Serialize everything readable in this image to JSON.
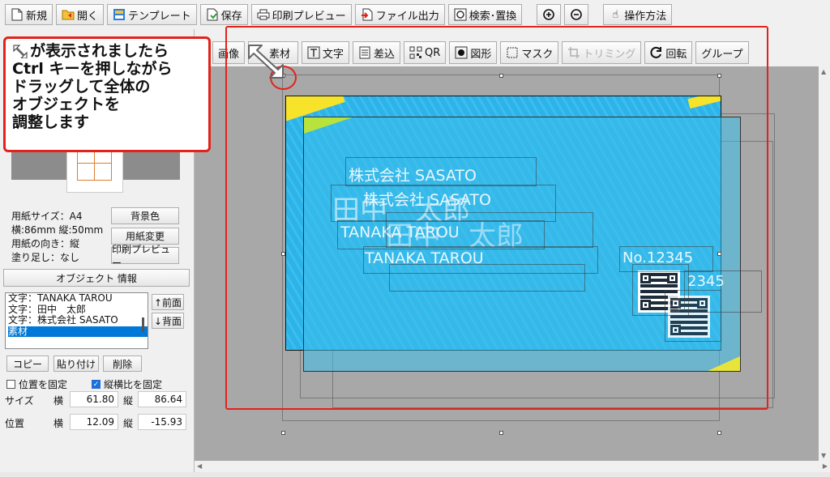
{
  "toolbar": {
    "new_label": "新規",
    "open_label": "開く",
    "template_label": "テンプレート",
    "save_label": "保存",
    "print_preview_label": "印刷プレビュー",
    "file_output_label": "ファイル出力",
    "search_replace_label": "検索･置換",
    "zoom_in_icon": "zoom-in-icon",
    "zoom_out_icon": "zoom-out-icon",
    "help_label": "操作方法"
  },
  "toolbar2": {
    "image_label": "画像",
    "material_label": "素材",
    "text_label": "文字",
    "merge_label": "差込",
    "qr_label": "QR",
    "shape_label": "図形",
    "mask_label": "マスク",
    "trimming_label": "トリミング",
    "rotate_label": "回転",
    "group_label": "グループ"
  },
  "paper": {
    "size": "用紙サイズ：A4",
    "dimensions": "横:86mm 縦:50mm",
    "orientation": "用紙の向き：縦",
    "bleed": "塗り足し：なし",
    "bg_color_button": "背景色",
    "change_paper_button": "用紙変更",
    "print_preview_button": "印刷プレビュー"
  },
  "object_info": {
    "header": "オブジェクト 情報",
    "items": [
      {
        "label": "文字：TANAKA TAROU",
        "selected": false
      },
      {
        "label": "文字：田中　太郎",
        "selected": false
      },
      {
        "label": "文字：株式会社 SASATO",
        "selected": false
      },
      {
        "label": "素材",
        "selected": true
      }
    ],
    "front_button": "↑前面",
    "back_button": "↓背面",
    "copy_button": "コピー",
    "paste_button": "貼り付け",
    "delete_button": "削除",
    "lock_position": {
      "label": "位置を固定",
      "checked": false
    },
    "keep_ratio": {
      "label": "縦横比を固定",
      "checked": true
    },
    "size_label": "サイズ",
    "position_label": "位置",
    "width_label": "横",
    "height_label": "縦",
    "size_w": "61.80",
    "size_h": "86.64",
    "pos_x": "12.09",
    "pos_y": "-15.93"
  },
  "card": {
    "company": "株式会社 SASATO",
    "name": "田中　太郎",
    "name_romaji": "TANAKA TAROU",
    "number": "No.12345",
    "number_partial": "2345"
  },
  "annotation": {
    "callout_lines": [
      "が表示されましたら",
      "Ctrl キーを押しながら",
      "ドラッグして全体の",
      "オブジェクトを",
      "調整します"
    ],
    "accent_color": "#e2231a"
  }
}
